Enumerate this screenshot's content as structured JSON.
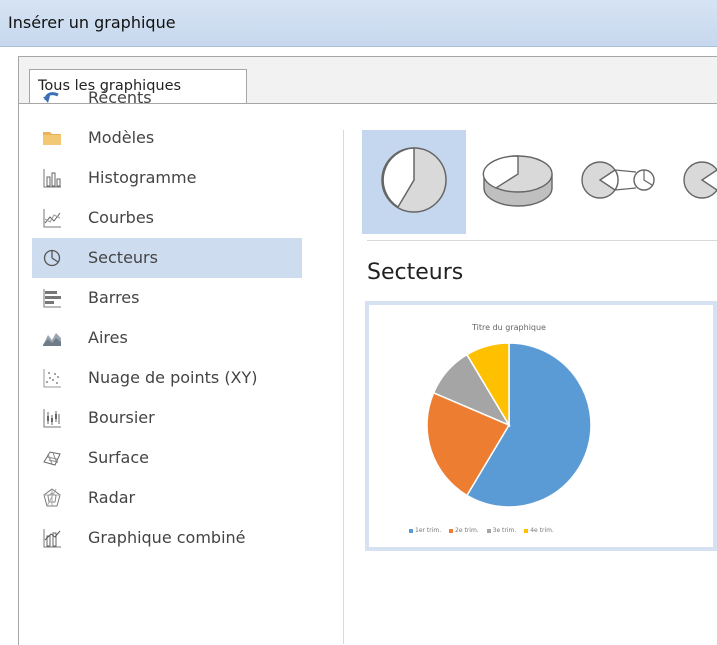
{
  "window": {
    "title": "Insérer un graphique"
  },
  "tabs": [
    {
      "label": "Tous les graphiques"
    }
  ],
  "sidebar": {
    "items": [
      {
        "label": "Récents"
      },
      {
        "label": "Modèles"
      },
      {
        "label": "Histogramme"
      },
      {
        "label": "Courbes"
      },
      {
        "label": "Secteurs"
      },
      {
        "label": "Barres"
      },
      {
        "label": "Aires"
      },
      {
        "label": "Nuage de points (XY)"
      },
      {
        "label": "Boursier"
      },
      {
        "label": "Surface"
      },
      {
        "label": "Radar"
      },
      {
        "label": "Graphique combiné"
      }
    ],
    "selected": "Secteurs"
  },
  "main": {
    "section_title": "Secteurs",
    "preview": {
      "title": "Titre du graphique",
      "legend": [
        "1er trim.",
        "2e trim.",
        "3e trim.",
        "4e trim."
      ]
    }
  },
  "chart_data": {
    "type": "pie",
    "title": "Titre du graphique",
    "categories": [
      "1er trim.",
      "2e trim.",
      "3e trim.",
      "4e trim."
    ],
    "values": [
      8.2,
      3.2,
      1.4,
      1.2
    ],
    "colors": [
      "#5b9bd5",
      "#ed7d31",
      "#a5a5a5",
      "#ffc000"
    ]
  },
  "colors": {
    "selection": "#cddcef",
    "accent": "#5b9bd5"
  }
}
